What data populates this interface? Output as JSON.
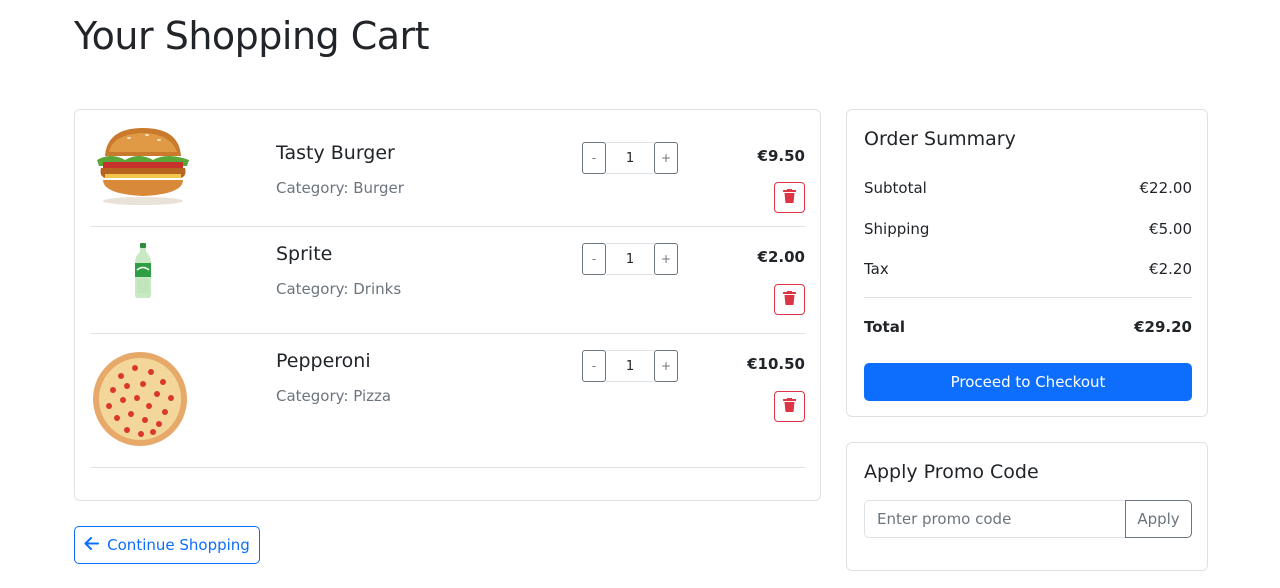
{
  "page": {
    "title": "Your Shopping Cart"
  },
  "cart": {
    "items": [
      {
        "name": "Tasty Burger",
        "category": "Category: Burger",
        "quantity": "1",
        "price": "€9.50",
        "minus": "-",
        "plus": "+"
      },
      {
        "name": "Sprite",
        "category": "Category: Drinks",
        "quantity": "1",
        "price": "€2.00",
        "minus": "-",
        "plus": "+"
      },
      {
        "name": "Pepperoni",
        "category": "Category: Pizza",
        "quantity": "1",
        "price": "€10.50",
        "minus": "-",
        "plus": "+"
      }
    ],
    "continue_label": "Continue Shopping"
  },
  "summary": {
    "title": "Order Summary",
    "subtotal_label": "Subtotal",
    "subtotal_value": "€22.00",
    "shipping_label": "Shipping",
    "shipping_value": "€5.00",
    "tax_label": "Tax",
    "tax_value": "€2.20",
    "total_label": "Total",
    "total_value": "€29.20",
    "checkout_label": "Proceed to Checkout"
  },
  "promo": {
    "title": "Apply Promo Code",
    "placeholder": "Enter promo code",
    "apply_label": "Apply"
  },
  "colors": {
    "primary": "#0d6efd",
    "danger": "#dc3545",
    "muted": "#6c757d",
    "border": "#dee2e6"
  }
}
